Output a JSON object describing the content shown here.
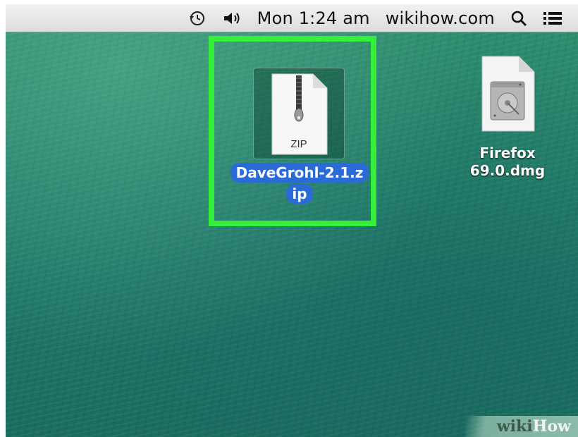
{
  "menubar": {
    "clock": "Mon 1:24 am",
    "site": "wikihow.com",
    "icons": [
      "time-machine-icon",
      "volume-icon",
      "spotlight-search-icon",
      "notification-center-icon"
    ]
  },
  "desktop": {
    "selected_file": {
      "label_line1": "DaveGrohl-2.1.z",
      "label_line2": "ip",
      "badge": "ZIP",
      "highlight_color": "#35ef3a",
      "selection_color": "#2a6bd8"
    },
    "dmg_file": {
      "label_line1": "Firefox",
      "label_line2": "69.0.dmg"
    }
  },
  "watermark": {
    "part1": "wiki",
    "part2": "How"
  }
}
